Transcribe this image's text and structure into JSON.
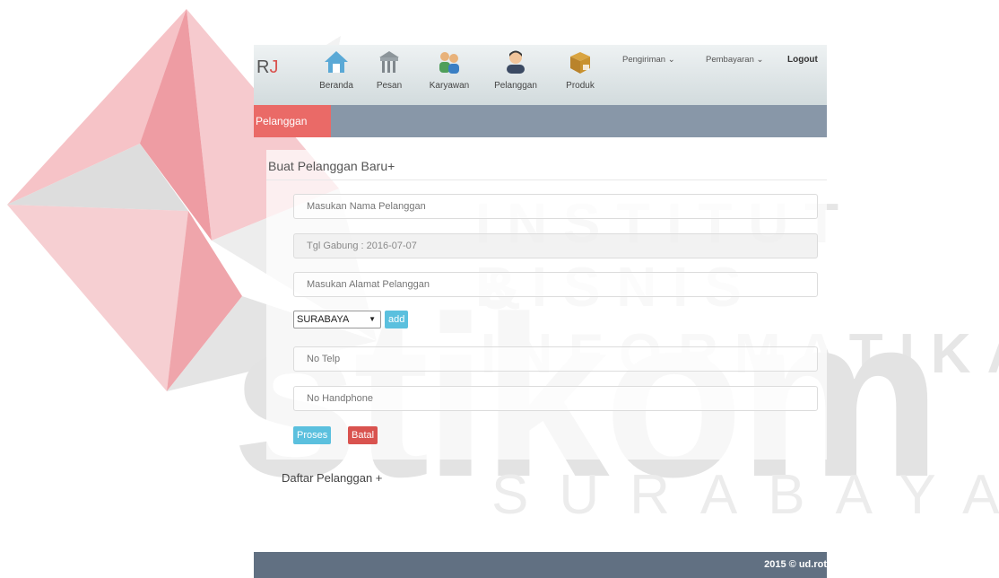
{
  "watermark": {
    "line1": "INSTITUT BISNIS",
    "line2": "& INFORMATIKA",
    "big": "stikom",
    "line4": "SURABAYA"
  },
  "brand": {
    "prefix": "R",
    "suffix": "J"
  },
  "nav": {
    "items": [
      {
        "label": "Beranda",
        "icon": "home-icon"
      },
      {
        "label": "Pesan",
        "icon": "order-icon"
      },
      {
        "label": "Karyawan",
        "icon": "employees-icon"
      },
      {
        "label": "Pelanggan",
        "icon": "customer-icon"
      },
      {
        "label": "Produk",
        "icon": "box-icon"
      }
    ],
    "pengiriman": "Pengiriman ⌄",
    "pembayaran": "Pembayaran ⌄",
    "logout": "Logout"
  },
  "subnav": {
    "active_tab": "Pelanggan"
  },
  "form": {
    "title": "Buat Pelanggan Baru+",
    "nama_placeholder": "Masukan Nama Pelanggan",
    "tgl_gabung": "Tgl Gabung : 2016-07-07",
    "alamat_placeholder": "Masukan Alamat Pelanggan",
    "kota_selected": "SURABAYA",
    "add_label": "add",
    "telp_placeholder": "No Telp",
    "hp_placeholder": "No Handphone",
    "proses_label": "Proses",
    "batal_label": "Batal"
  },
  "list": {
    "title": "Daftar Pelanggan +"
  },
  "footer": {
    "text": "2015 © ud.rot"
  },
  "colors": {
    "accent_tab": "#ea6a67",
    "subbar": "#8897a8",
    "footer": "#617082",
    "btn_info": "#5bc0de",
    "btn_danger": "#d9534f"
  }
}
